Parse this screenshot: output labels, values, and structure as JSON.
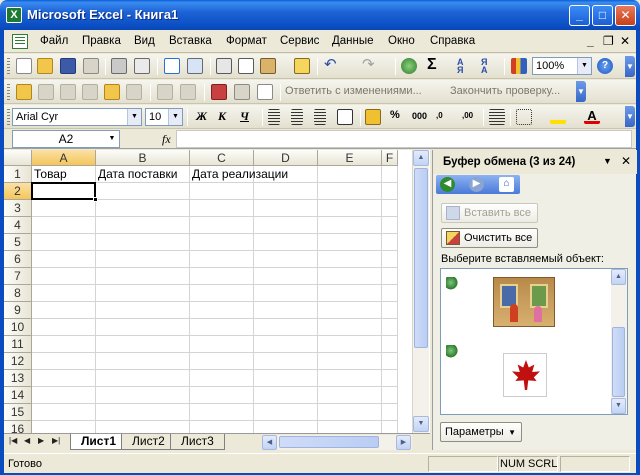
{
  "window": {
    "title": "Microsoft Excel - Книга1",
    "min_label": "_",
    "max_label": "□",
    "close_label": "✕"
  },
  "menu": {
    "items": [
      "Файл",
      "Правка",
      "Вид",
      "Вставка",
      "Формат",
      "Сервис",
      "Данные",
      "Окно",
      "Справка"
    ],
    "mdi_min": "_",
    "mdi_restore": "❐",
    "mdi_close": "✕"
  },
  "standard_toolbar": {
    "zoom": "100%",
    "sum_symbol": "Σ"
  },
  "review_toolbar": {
    "reply_changes": "Ответить с изменениями...",
    "end_review": "Закончить проверку..."
  },
  "format_toolbar": {
    "font_name": "Arial Cyr",
    "font_size": "10",
    "bold": "Ж",
    "italic": "К",
    "underline": "Ч",
    "percent": "%",
    "thousands": "000",
    "decimal_inc": ",0​00",
    "decimal_dec": ",00"
  },
  "formula_bar": {
    "name_box": "A2",
    "fx": "fx",
    "value": ""
  },
  "sheet": {
    "columns": [
      "A",
      "B",
      "C",
      "D",
      "E",
      "F"
    ],
    "rows": [
      "1",
      "2",
      "3",
      "4",
      "5",
      "6",
      "7",
      "8",
      "9",
      "10",
      "11",
      "12",
      "13",
      "14",
      "15",
      "16"
    ],
    "cells": {
      "A1": "Товар",
      "B1": "Дата поставки",
      "C1": "Дата реализации"
    },
    "tabs": [
      "Лист1",
      "Лист2",
      "Лист3"
    ],
    "active_tab": "Лист1",
    "active_cell": "A2"
  },
  "task_pane": {
    "title": "Буфер обмена (3 из 24)",
    "paste_all": "Вставить все",
    "clear_all": "Очистить все",
    "select_label": "Выберите вставляемый объект:",
    "params": "Параметры"
  },
  "status": {
    "ready": "Готово",
    "num": "NUM",
    "scrl": "SCRL"
  },
  "colors": {
    "title_blue": "#0b4fc4",
    "active_header": "#f4c65b",
    "grid_line": "#d4d4d4"
  }
}
